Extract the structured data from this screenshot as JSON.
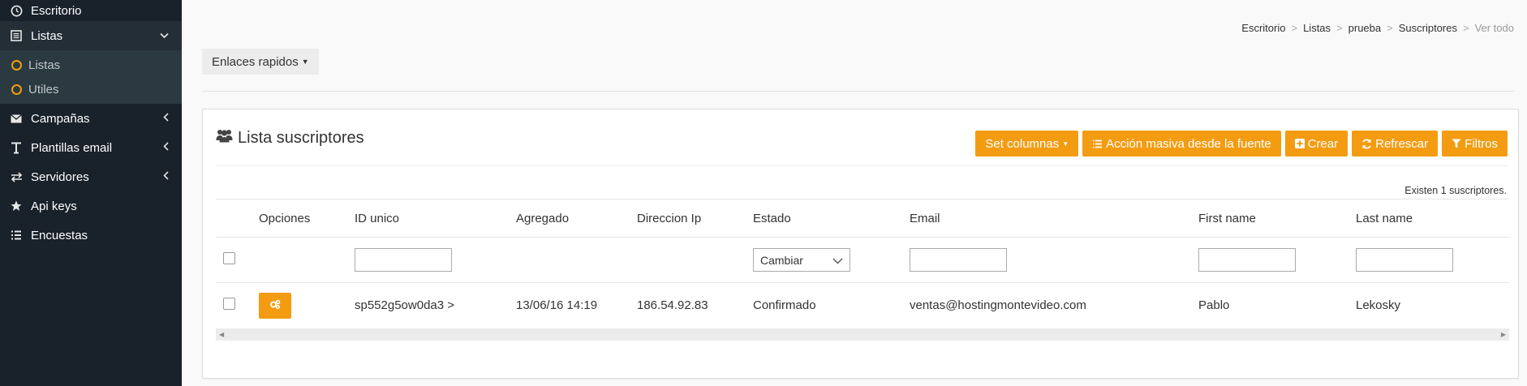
{
  "sidebar": {
    "items": [
      {
        "label": "Escritorio",
        "icon": "dashboard-icon"
      },
      {
        "label": "Listas",
        "icon": "list-icon",
        "active": true
      },
      {
        "label": "Campañas",
        "icon": "envelope-icon"
      },
      {
        "label": "Plantillas email",
        "icon": "text-icon"
      },
      {
        "label": "Servidores",
        "icon": "exchange-icon"
      },
      {
        "label": "Api keys",
        "icon": "star-icon"
      },
      {
        "label": "Encuestas",
        "icon": "list-icon"
      }
    ],
    "submenu": [
      {
        "label": "Listas"
      },
      {
        "label": "Utiles"
      }
    ]
  },
  "breadcrumb": [
    "Escritorio",
    "Listas",
    "prueba",
    "Suscriptores",
    "Ver todo"
  ],
  "quicklinks_label": "Enlaces rapidos",
  "panel": {
    "title": "Lista suscriptores",
    "buttons": {
      "set_columns": "Set columnas",
      "bulk_action": "Acción masiva desde la fuente",
      "create": "Crear",
      "refresh": "Refrescar",
      "filters": "Filtros"
    },
    "count_text": "Existen 1 suscriptores."
  },
  "table": {
    "columns": [
      "Opciones",
      "ID unico",
      "Agregado",
      "Direccion Ip",
      "Estado",
      "Email",
      "First name",
      "Last name"
    ],
    "status_filter_value": "Cambiar",
    "rows": [
      {
        "id": "sp552g5ow0da3 >",
        "added": "13/06/16 14:19",
        "ip": "186.54.92.83",
        "status": "Confirmado",
        "email": "ventas@hostingmontevideo.com",
        "first_name": "Pablo",
        "last_name": "Lekosky"
      }
    ]
  },
  "colors": {
    "sidebar_bg": "#19212a",
    "submenu_bg": "#2b3a40",
    "accent": "#f39c12"
  }
}
